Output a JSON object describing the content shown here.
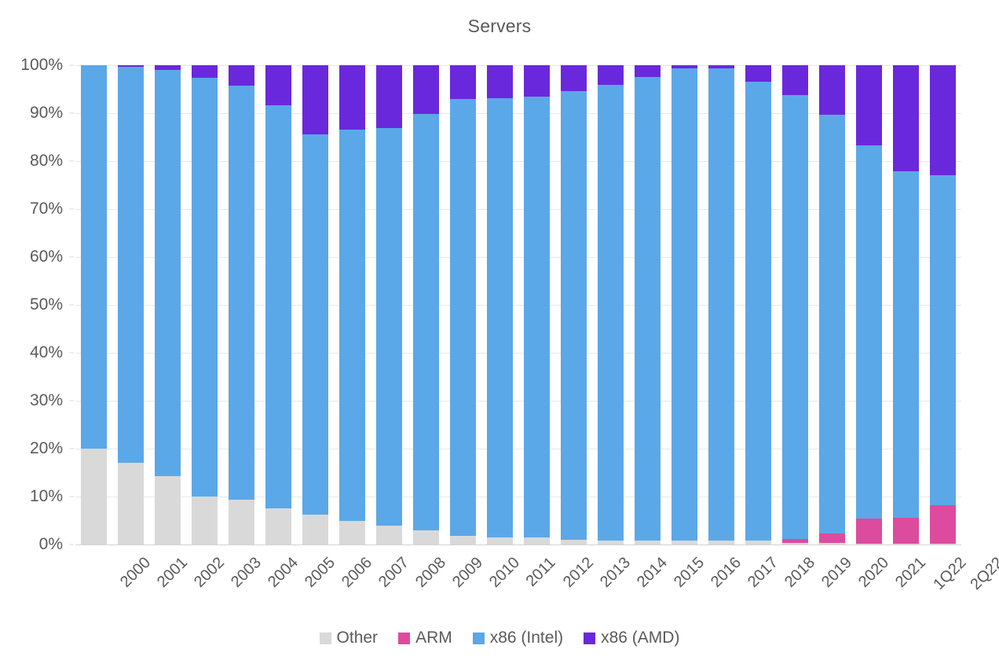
{
  "chart": {
    "title": "Servers"
  },
  "chart_data": {
    "type": "bar",
    "subtype": "stacked-percent",
    "title": "Servers",
    "subtitle": "",
    "xlabel": "",
    "ylabel": "",
    "ylim": [
      0,
      100
    ],
    "ytick_labels": [
      "0%",
      "10%",
      "20%",
      "30%",
      "40%",
      "50%",
      "60%",
      "70%",
      "80%",
      "90%",
      "100%"
    ],
    "ytick_values": [
      0,
      10,
      20,
      30,
      40,
      50,
      60,
      70,
      80,
      90,
      100
    ],
    "grid": true,
    "legend_position": "bottom",
    "stack_order": [
      "Other",
      "ARM",
      "x86 (Intel)",
      "x86 (AMD)"
    ],
    "categories": [
      "2000",
      "2001",
      "2002",
      "2003",
      "2004",
      "2005",
      "2006",
      "2007",
      "2008",
      "2009",
      "2010",
      "2011",
      "2012",
      "2013",
      "2014",
      "2015",
      "2016",
      "2017",
      "2018",
      "2019",
      "2020",
      "2021",
      "1Q22",
      "2Q22"
    ],
    "series": [
      {
        "name": "Other",
        "color": "#d9d9d9",
        "values": [
          20.0,
          17.0,
          14.2,
          10.0,
          9.3,
          7.6,
          6.2,
          5.0,
          3.9,
          3.0,
          1.8,
          1.5,
          1.4,
          1.0,
          0.8,
          0.8,
          0.8,
          0.9,
          0.9,
          0.4,
          0.3,
          0.2,
          0.2,
          0.2
        ]
      },
      {
        "name": "ARM",
        "color": "#dd4b9e",
        "values": [
          0,
          0,
          0,
          0,
          0,
          0,
          0,
          0,
          0,
          0,
          0,
          0,
          0,
          0,
          0,
          0,
          0,
          0,
          0,
          0.8,
          2.0,
          5.2,
          5.4,
          8.0
        ]
      },
      {
        "name": "x86 (Intel)",
        "color": "#5ba8e8",
        "values": [
          80.0,
          82.6,
          84.9,
          87.3,
          86.4,
          84.1,
          79.3,
          81.6,
          83.0,
          86.8,
          91.2,
          91.7,
          92.0,
          93.6,
          95.1,
          96.8,
          98.5,
          98.5,
          95.7,
          92.5,
          87.4,
          77.8,
          72.3,
          68.8
        ]
      },
      {
        "name": "x86 (AMD)",
        "color": "#6a28dc",
        "values": [
          0.0,
          0.4,
          0.9,
          2.7,
          4.3,
          8.3,
          14.5,
          13.4,
          13.1,
          10.2,
          7.0,
          6.8,
          6.6,
          5.4,
          4.1,
          2.4,
          0.7,
          0.6,
          3.4,
          6.3,
          10.3,
          16.8,
          22.1,
          23.0
        ]
      }
    ]
  },
  "legend": {
    "items": [
      {
        "label": "Other",
        "color": "#d9d9d9"
      },
      {
        "label": "ARM",
        "color": "#dd4b9e"
      },
      {
        "label": "x86 (Intel)",
        "color": "#5ba8e8"
      },
      {
        "label": "x86 (AMD)",
        "color": "#6a28dc"
      }
    ]
  }
}
